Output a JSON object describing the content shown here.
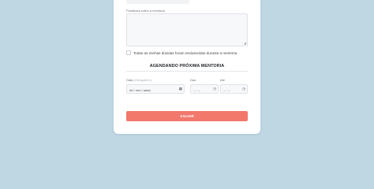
{
  "feedback": {
    "label": "Feedback sobre a mentoria",
    "value": ""
  },
  "doubts_checkbox": {
    "label": "Todas as minhas dúvidas foram esclarecidas durante a mentoria",
    "checked": false
  },
  "schedule": {
    "title": "AGENDANDO PRÓXIMA MENTORIA",
    "date": {
      "label": "Data",
      "hint": "(Obrigatório)",
      "value": "dd / mm / aaaa",
      "icon": "calendar-icon"
    },
    "start": {
      "label": "Das",
      "value": "-- : --",
      "icon": "clock-icon"
    },
    "end": {
      "label": "Até",
      "value": "-- : --",
      "icon": "clock-icon"
    }
  },
  "save_button": {
    "label": "SALVAR"
  },
  "colors": {
    "background": "#bed7e3",
    "accent": "#f2786c",
    "card": "#ffffff"
  }
}
